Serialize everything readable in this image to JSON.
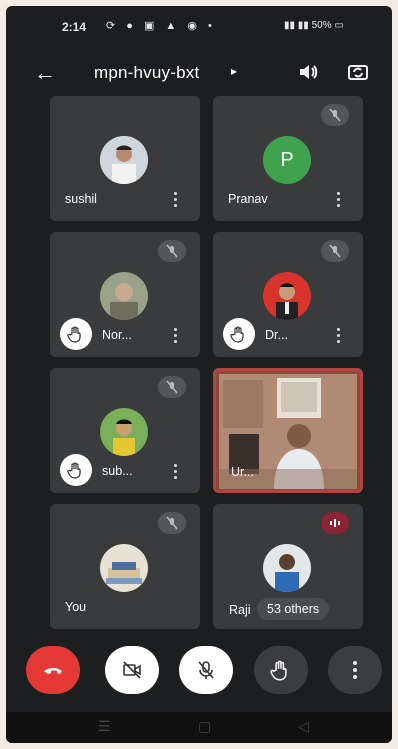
{
  "status_bar": {
    "time": "2:14",
    "network": "\"ᵀ᾿ᵀᴵ",
    "battery": "50%"
  },
  "header": {
    "meeting_code": "mpn-hvuy-bxt",
    "caret": "▸"
  },
  "participants": [
    {
      "name": "sushil"
    },
    {
      "name": "Pranav",
      "initial": "P"
    },
    {
      "name": "Nor..."
    },
    {
      "name": "Dr..."
    },
    {
      "name": "sub..."
    },
    {
      "name": "Ur..."
    },
    {
      "name": "You"
    },
    {
      "name": "Raji"
    }
  ],
  "others_badge": "53 others",
  "colors": {
    "leave": "#e53935",
    "pranav_avatar": "#3fa34d",
    "active_border": "#b44444"
  }
}
